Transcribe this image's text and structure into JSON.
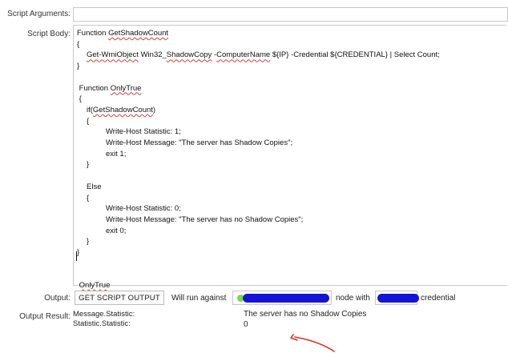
{
  "labels": {
    "script_arguments": "Script Arguments:",
    "script_body": "Script Body:",
    "output": "Output:",
    "output_result": "Output Result:"
  },
  "script_arguments_value": "",
  "code_lines": [
    {
      "indent": 0,
      "parts": [
        {
          "t": "Function "
        },
        {
          "t": "GetShadowCount",
          "sq": true
        }
      ]
    },
    {
      "indent": 0,
      "parts": [
        {
          "t": "{"
        }
      ]
    },
    {
      "indent": 1,
      "parts": [
        {
          "t": "Get-WmiObject",
          "sq": true
        },
        {
          "t": " Win32_"
        },
        {
          "t": "ShadowCopy",
          "sq": true
        },
        {
          "t": " -"
        },
        {
          "t": "ComputerName",
          "sq": true
        },
        {
          "t": " ${IP} -Credential ${CREDENTIAL} | Select Count;"
        }
      ]
    },
    {
      "indent": 0,
      "parts": [
        {
          "t": "}"
        }
      ]
    },
    {
      "indent": 0,
      "parts": [
        {
          "t": ""
        }
      ]
    },
    {
      "indent": 0,
      "parts": [
        {
          "t": " Function "
        },
        {
          "t": "OnlyTrue",
          "sq": true
        }
      ]
    },
    {
      "indent": 0,
      "parts": [
        {
          "t": " {"
        }
      ]
    },
    {
      "indent": 1,
      "parts": [
        {
          "t": "if("
        },
        {
          "t": "GetShadowCount",
          "sq": true
        },
        {
          "t": ")"
        }
      ]
    },
    {
      "indent": 1,
      "parts": [
        {
          "t": "{"
        }
      ]
    },
    {
      "indent": 3,
      "parts": [
        {
          "t": "Write-Host Statistic: 1;"
        }
      ]
    },
    {
      "indent": 3,
      "parts": [
        {
          "t": "Write-Host Message: \"The server has Shadow Copies\";"
        }
      ]
    },
    {
      "indent": 3,
      "parts": [
        {
          "t": "exit 1;"
        }
      ]
    },
    {
      "indent": 1,
      "parts": [
        {
          "t": "}"
        }
      ]
    },
    {
      "indent": 0,
      "parts": [
        {
          "t": ""
        }
      ]
    },
    {
      "indent": 1,
      "parts": [
        {
          "t": "Else"
        }
      ]
    },
    {
      "indent": 1,
      "parts": [
        {
          "t": "{"
        }
      ]
    },
    {
      "indent": 3,
      "parts": [
        {
          "t": "Write-Host Statistic: 0;"
        }
      ]
    },
    {
      "indent": 3,
      "parts": [
        {
          "t": "Write-Host Message: \"The server has no Shadow Copies\";"
        }
      ]
    },
    {
      "indent": 3,
      "parts": [
        {
          "t": "exit 0;"
        }
      ]
    },
    {
      "indent": 1,
      "parts": [
        {
          "t": "}"
        }
      ]
    },
    {
      "indent": 0,
      "parts": [
        {
          "t": "}"
        }
      ]
    },
    {
      "indent": 0,
      "parts": [
        {
          "t": ""
        }
      ]
    },
    {
      "indent": 0,
      "parts": [
        {
          "t": ""
        }
      ]
    },
    {
      "indent": 0,
      "parts": [
        {
          "t": " "
        },
        {
          "t": "OnlyTrue",
          "sq": true
        }
      ]
    }
  ],
  "output": {
    "button_label": "GET SCRIPT OUTPUT",
    "will_run_text": "Will run against",
    "node_with_text": "node with",
    "credential_text": "credential"
  },
  "results": [
    {
      "key": "Message.Statistic:",
      "value": "The server has no Shadow Copies"
    },
    {
      "key": "Statistic.Statistic:",
      "value": "0"
    }
  ],
  "colors": {
    "redaction": "#1414d6",
    "status_dot": "#7bd64a",
    "arrow": "#e0302a"
  }
}
